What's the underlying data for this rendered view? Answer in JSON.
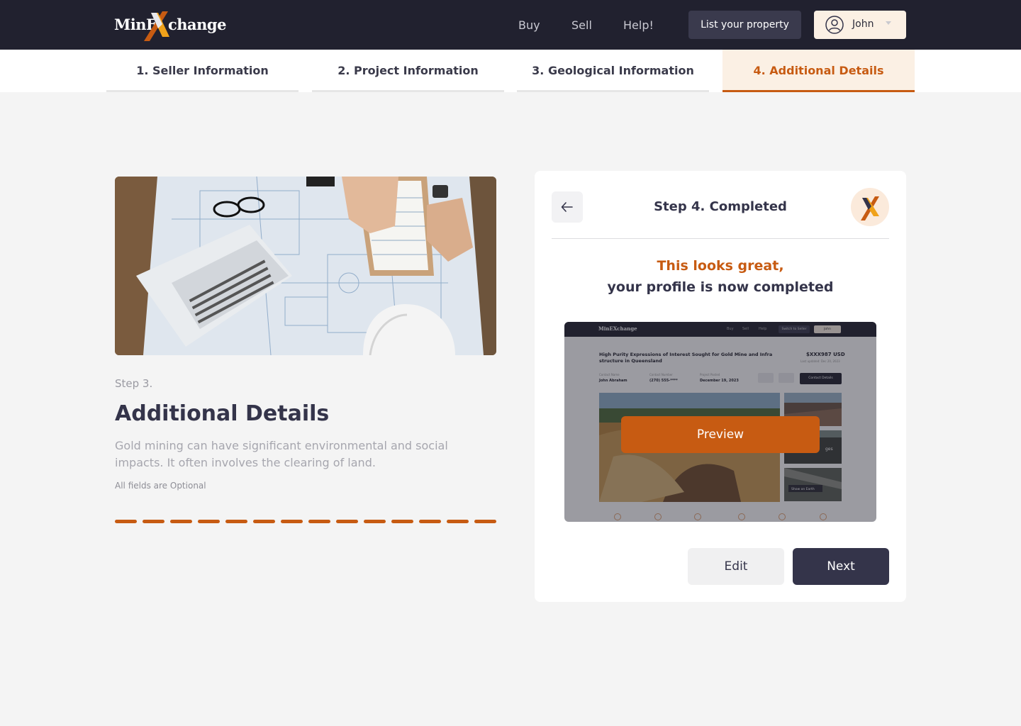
{
  "brand": {
    "logo_part1": "MinE",
    "logo_part2": "change",
    "accent": "#c75b12",
    "dark": "#21212f"
  },
  "nav": {
    "links": [
      "Buy",
      "Sell",
      "Help!"
    ],
    "list_property": "List your property",
    "user_name": "John",
    "user_icon": "user-circle-icon",
    "caret_icon": "chevron-down-icon"
  },
  "steps": [
    {
      "label": "1. Seller Information",
      "active": false
    },
    {
      "label": "2. Project Information",
      "active": false
    },
    {
      "label": "3. Geological Information",
      "active": false
    },
    {
      "label": "4. Additional Details",
      "active": true
    }
  ],
  "left": {
    "image_icon": "blueprint-laptop-photo",
    "step_label": "Step 3.",
    "title": "Additional Details",
    "description": "Gold mining can have significant environmental and social impacts. It often involves the clearing of land.",
    "optional_note": "All fields are Optional",
    "progress": {
      "segments": 14,
      "completed": 14
    }
  },
  "card": {
    "back_icon": "arrow-left-icon",
    "title": "Step 4. Completed",
    "headline_1": "This looks great,",
    "headline_2": "your profile is now completed",
    "preview": {
      "logo": "MinEXchange",
      "nav": [
        "Buy",
        "Sell",
        "Help"
      ],
      "switch_button": "Switch to Seller",
      "user": "John",
      "listing_title": "High Purity Expressions of Interest Sought for Gold Mine and Infra structure in Queensland",
      "price": "$XXX987 USD",
      "updated": "Last updated: Dec 20, 2023",
      "meta": [
        {
          "label": "Contact Name",
          "value": "John Abraham"
        },
        {
          "label": "Contact Number",
          "value": "(270) 555-****"
        },
        {
          "label": "Project Posted",
          "value": "December 19, 2023"
        }
      ],
      "contact_button": "Contact Details",
      "thumb_overlay_1": "ges",
      "thumb_overlay_2": "Show on Earth",
      "button": "Preview"
    },
    "edit_button": "Edit",
    "next_button": "Next"
  }
}
